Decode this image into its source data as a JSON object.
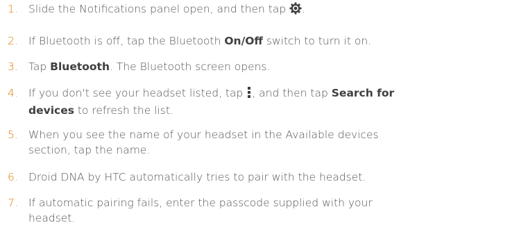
{
  "steps": [
    {
      "number": "1.",
      "parts": {
        "a": "Slide the Notifications panel open, and then tap ",
        "icon": "settings-gear-icon",
        "b": "."
      }
    },
    {
      "number": "2.",
      "parts": {
        "a": "If Bluetooth is off, tap the Bluetooth ",
        "bold": "On/Off",
        "b": " switch to turn it on."
      }
    },
    {
      "number": "3.",
      "parts": {
        "a": "Tap ",
        "bold": "Bluetooth",
        "b": ". The Bluetooth screen opens."
      }
    },
    {
      "number": "4.",
      "parts": {
        "a": "If you don't see your headset listed, tap ",
        "icon": "menu-dots-icon",
        "b": ", and then tap ",
        "bold1": "Search for",
        "bold2": "devices",
        "c": " to refresh the list."
      }
    },
    {
      "number": "5.",
      "parts": {
        "line1": "When you see the name of your headset in the Available devices",
        "line2": "section, tap the name."
      }
    },
    {
      "number": "6.",
      "parts": {
        "a": "Droid DNA by HTC automatically tries to pair with the headset."
      }
    },
    {
      "number": "7.",
      "parts": {
        "line1": "If automatic pairing fails, enter the passcode supplied with your",
        "line2": "headset."
      }
    }
  ],
  "colors": {
    "number": "#e07a00",
    "text": "#555555",
    "bold": "#3f3f3f"
  }
}
